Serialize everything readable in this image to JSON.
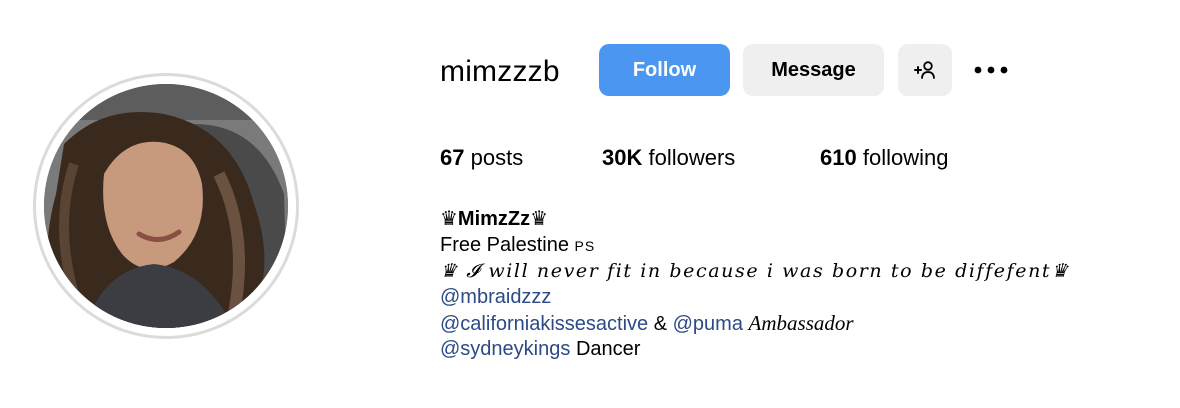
{
  "profile": {
    "username": "mimzzzb",
    "buttons": {
      "follow": "Follow",
      "message": "Message",
      "suggest_icon": "+👤",
      "more_icon": "•••"
    },
    "stats": {
      "posts_count": "67",
      "posts_label": "posts",
      "followers_count": "30K",
      "followers_label": "followers",
      "following_count": "610",
      "following_label": "following"
    },
    "bio": {
      "name": "♛MimzZz♛",
      "line1_text": "Free Palestine",
      "line1_flag": "PS",
      "line2": "♛ 𝓘 will never fit in because i was born to be diffefent♛",
      "mention1": "@mbraidzzz",
      "mention2": "@californiakissesactive",
      "amp": "&",
      "mention3": "@puma",
      "ambassador": "Ambassador",
      "mention4": "@sydneykings",
      "dancer": "Dancer"
    }
  },
  "colors": {
    "follow_bg": "#4a96f0",
    "secondary_btn_bg": "#efefef",
    "link": "#2b4a86",
    "avatar_ring": "#dbdbdb"
  },
  "icons": {
    "avatar": "profile-photo",
    "suggest": "add-person-icon",
    "more": "more-options-icon"
  }
}
